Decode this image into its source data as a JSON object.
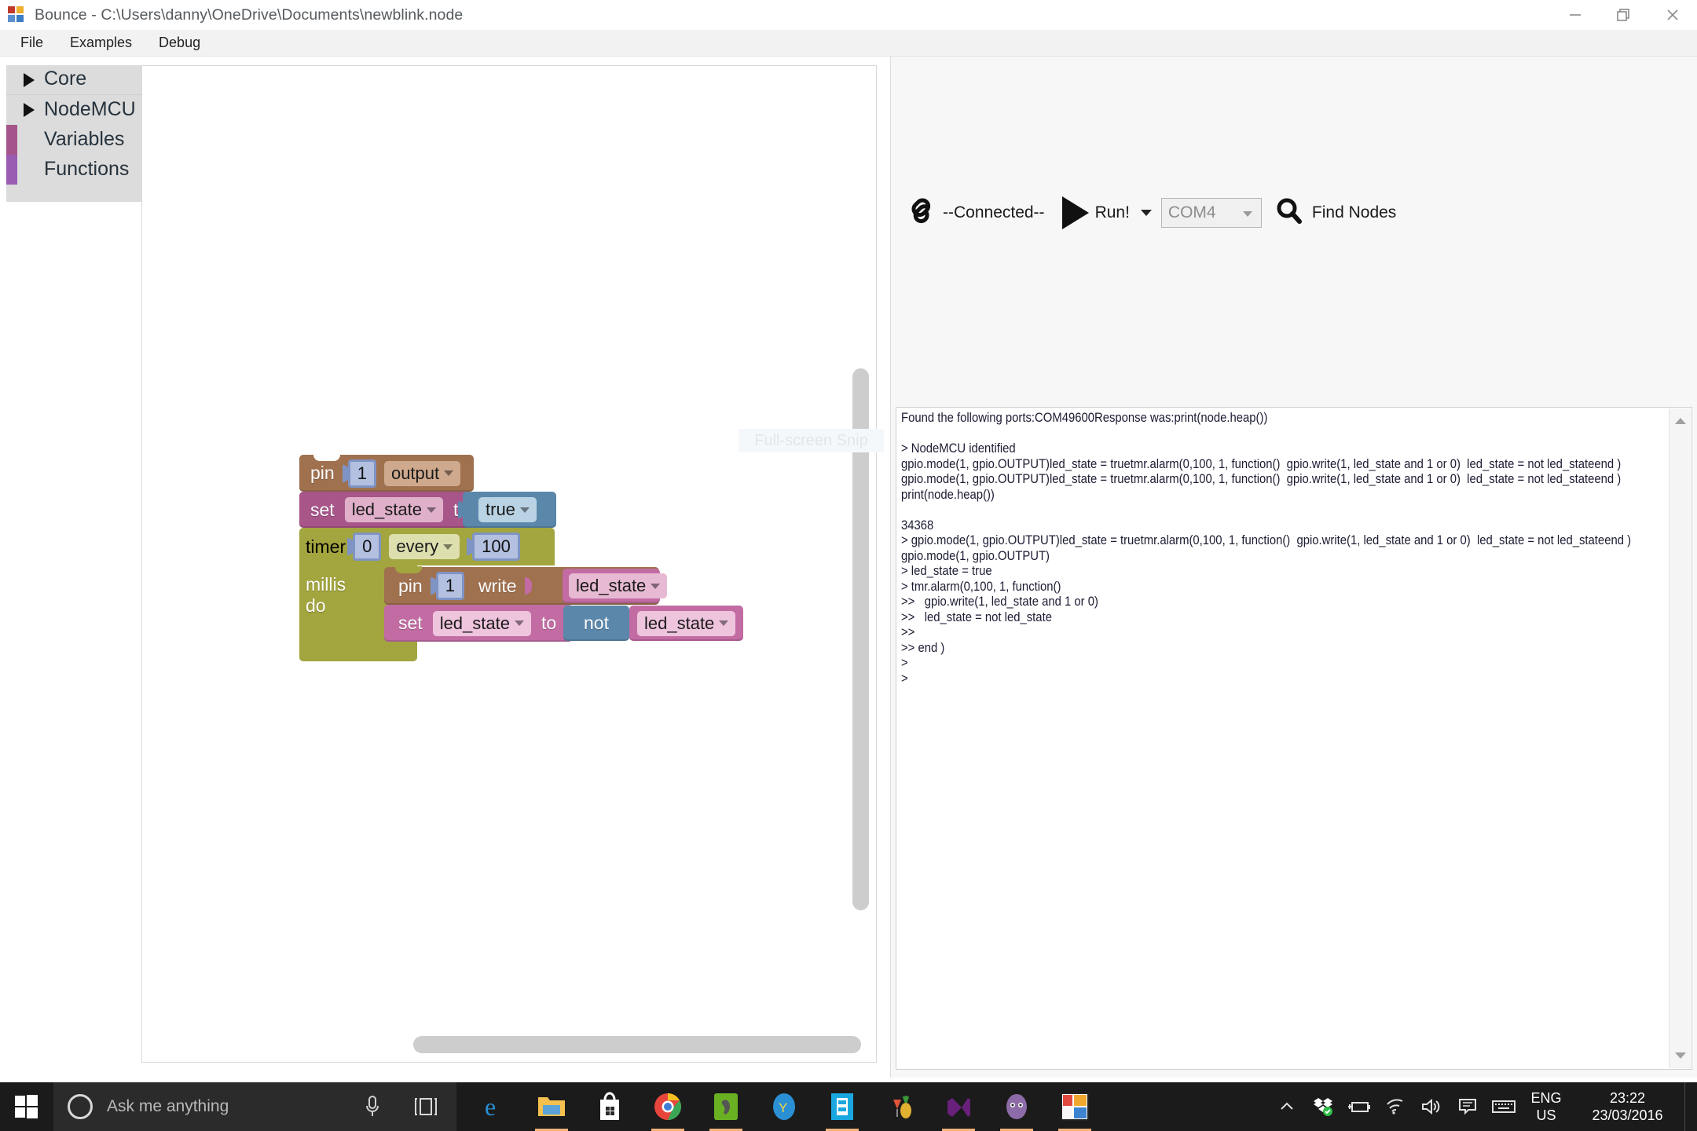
{
  "window": {
    "app_name": "Bounce",
    "title": "Bounce - C:\\Users\\danny\\OneDrive\\Documents\\newblink.node",
    "controls": {
      "minimize": "minimize",
      "restore": "restore",
      "close": "close"
    }
  },
  "menubar": {
    "items": [
      "File",
      "Examples",
      "Debug"
    ]
  },
  "toolbox": {
    "items": [
      {
        "label": "Core",
        "kind": "category",
        "expandable": true,
        "color": ""
      },
      {
        "label": "NodeMCU",
        "kind": "category",
        "expandable": true,
        "color": ""
      },
      {
        "label": "Variables",
        "kind": "swatch",
        "expandable": false,
        "color": "#a5558a"
      },
      {
        "label": "Functions",
        "kind": "swatch",
        "expandable": false,
        "color": "#9a5bb3"
      }
    ]
  },
  "workspace": {
    "ghost_overlay_text": "Full-screen Snip",
    "trash_icon": "trash-icon",
    "blocks": {
      "pin_output": {
        "label": "pin",
        "pin_number": "1",
        "mode": "output",
        "color": "#a0714f"
      },
      "set_led_state_true": {
        "set_label": "set",
        "variable": "led_state",
        "to_label": "to",
        "value": "true",
        "color": "#a8558a",
        "value_color": "#5b87ab"
      },
      "timer": {
        "label": "timer",
        "index": "0",
        "mode": "every",
        "interval": "100",
        "unit_label": "millis do",
        "color": "#a3a53f"
      },
      "pin_write": {
        "label": "pin",
        "pin_number": "1",
        "action": "write",
        "value": "led_state",
        "color": "#a0714f"
      },
      "set_led_state_not": {
        "set_label": "set",
        "variable": "led_state",
        "to_label": "to",
        "operator": "not",
        "operand": "led_state",
        "color": "#c26ca3",
        "operator_color": "#5b87ab"
      }
    }
  },
  "toolbar": {
    "link_icon": "chain-link-icon",
    "connection_status": "--Connected--",
    "run_label": "Run!",
    "run_icon": "play-triangle-icon",
    "run_dropdown_icon": "chevron-down-icon",
    "port_select": {
      "value": "COM4",
      "options": [
        "COM4"
      ]
    },
    "find_nodes_label": "Find Nodes",
    "find_icon": "magnifier-icon"
  },
  "console": {
    "lines": [
      "Found the following ports:COM49600Response was:print(node.heap())",
      "",
      "> NodeMCU identified",
      "gpio.mode(1, gpio.OUTPUT)led_state = truetmr.alarm(0,100, 1, function()  gpio.write(1, led_state and 1 or 0)  led_state = not led_stateend )",
      "gpio.mode(1, gpio.OUTPUT)led_state = truetmr.alarm(0,100, 1, function()  gpio.write(1, led_state and 1 or 0)  led_state = not led_stateend )",
      "print(node.heap())",
      "",
      "34368",
      "> gpio.mode(1, gpio.OUTPUT)led_state = truetmr.alarm(0,100, 1, function()  gpio.write(1, led_state and 1 or 0)  led_state = not led_stateend )",
      "gpio.mode(1, gpio.OUTPUT)",
      "> led_state = true",
      "> tmr.alarm(0,100, 1, function()",
      ">>   gpio.write(1, led_state and 1 or 0)",
      ">>   led_state = not led_state",
      ">>",
      ">> end )",
      ">",
      ">"
    ]
  },
  "taskbar": {
    "start_icon": "windows-start-icon",
    "search": {
      "placeholder": "Ask me anything",
      "mic_icon": "microphone-icon",
      "ring_icon": "cortana-ring-icon"
    },
    "task_view_icon": "task-view-icon",
    "apps": [
      {
        "name": "edge-icon",
        "running": false
      },
      {
        "name": "file-explorer-icon",
        "running": true
      },
      {
        "name": "microsoft-store-icon",
        "running": false
      },
      {
        "name": "chrome-icon",
        "running": true
      },
      {
        "name": "evernote-icon",
        "running": true
      },
      {
        "name": "yandex-icon",
        "running": false
      },
      {
        "name": "movie-maker-icon",
        "running": true
      },
      {
        "name": "pineapple-icon",
        "running": false
      },
      {
        "name": "visual-studio-icon",
        "running": true
      },
      {
        "name": "github-icon",
        "running": true
      },
      {
        "name": "bounce-app-icon",
        "running": true
      }
    ],
    "tray": {
      "icons": [
        "chevron-up-icon",
        "dropbox-icon",
        "battery-icon",
        "wifi-icon",
        "volume-icon",
        "action-center-icon",
        "keyboard-icon"
      ],
      "language": {
        "line1": "ENG",
        "line2": "US"
      },
      "clock": {
        "time": "23:22",
        "date": "23/03/2016"
      }
    }
  }
}
